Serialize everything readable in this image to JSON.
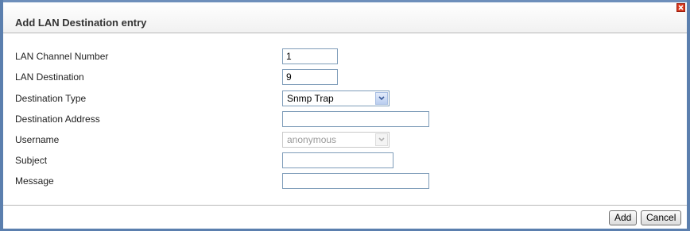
{
  "dialog": {
    "title": "Add LAN Destination entry",
    "close_icon": "close-icon"
  },
  "form": {
    "lan_channel_number": {
      "label": "LAN Channel Number",
      "value": "1"
    },
    "lan_destination": {
      "label": "LAN Destination",
      "value": "9"
    },
    "destination_type": {
      "label": "Destination Type",
      "selected": "Snmp Trap"
    },
    "destination_address": {
      "label": "Destination Address",
      "value": ""
    },
    "username": {
      "label": "Username",
      "selected": "anonymous",
      "disabled": true
    },
    "subject": {
      "label": "Subject",
      "value": ""
    },
    "message": {
      "label": "Message",
      "value": ""
    }
  },
  "footer": {
    "add_label": "Add",
    "cancel_label": "Cancel"
  },
  "colors": {
    "frame_blue": "#5b7fae",
    "close_red": "#d93a1f",
    "input_border": "#7f9db9"
  }
}
